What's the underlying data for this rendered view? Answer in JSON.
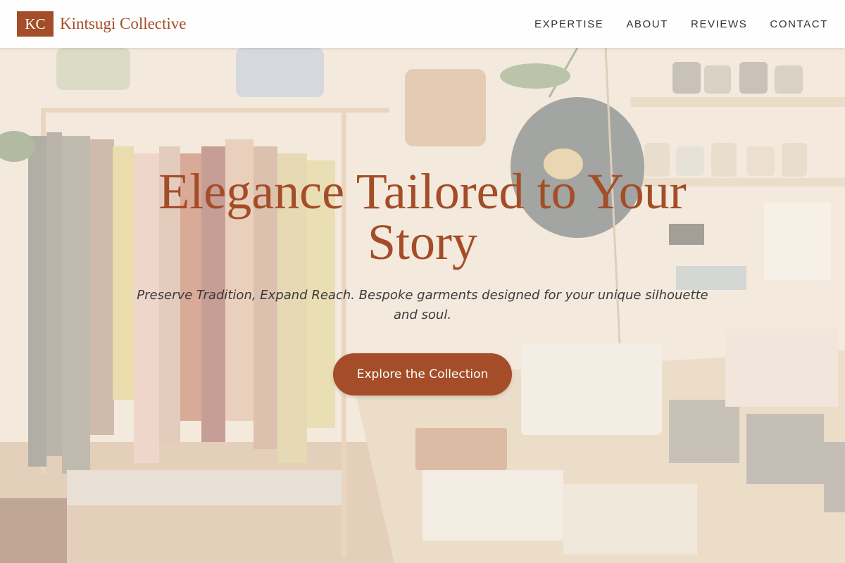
{
  "brand": {
    "logo_initials": "KC",
    "name": "Kintsugi Collective"
  },
  "nav": {
    "items": [
      {
        "label": "EXPERTISE"
      },
      {
        "label": "ABOUT"
      },
      {
        "label": "REVIEWS"
      },
      {
        "label": "CONTACT"
      }
    ]
  },
  "hero": {
    "title": "Elegance Tailored to Your Story",
    "subtitle": "Preserve Tradition, Expand Reach. Bespoke garments designed for your unique silhouette and soul.",
    "cta_label": "Explore the Collection",
    "background_image": "boutique-interior-photo"
  },
  "colors": {
    "accent": "#a44d28",
    "header_bg": "#ffffff",
    "text_dark": "#333333"
  }
}
